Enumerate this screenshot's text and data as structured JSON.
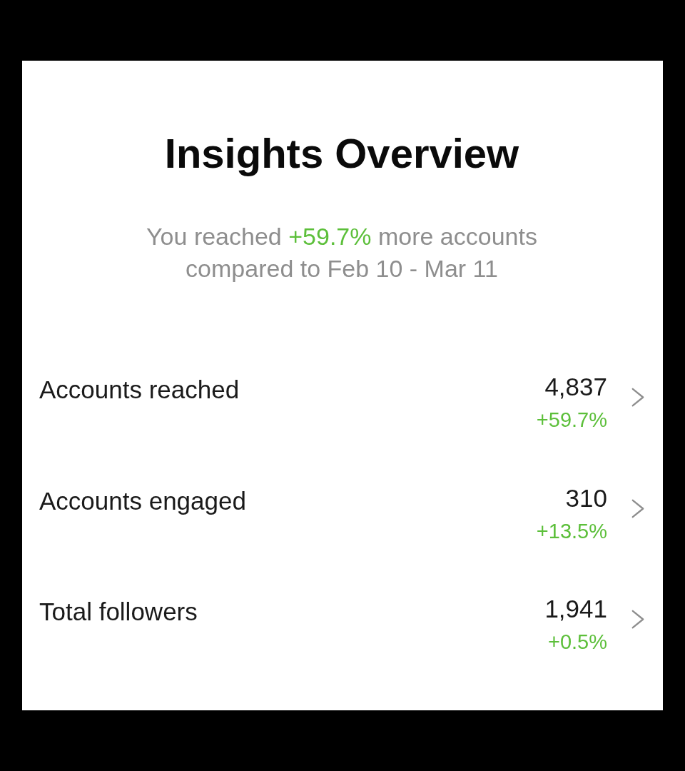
{
  "title": "Insights Overview",
  "summary": {
    "before": "You reached",
    "highlight": "+59.7%",
    "after": "more accounts compared to Feb 10 - Mar 11"
  },
  "metrics": [
    {
      "label": "Accounts reached",
      "value": "4,837",
      "change": "+59.7%"
    },
    {
      "label": "Accounts engaged",
      "value": "310",
      "change": "+13.5%"
    },
    {
      "label": "Total followers",
      "value": "1,941",
      "change": "+0.5%"
    }
  ]
}
